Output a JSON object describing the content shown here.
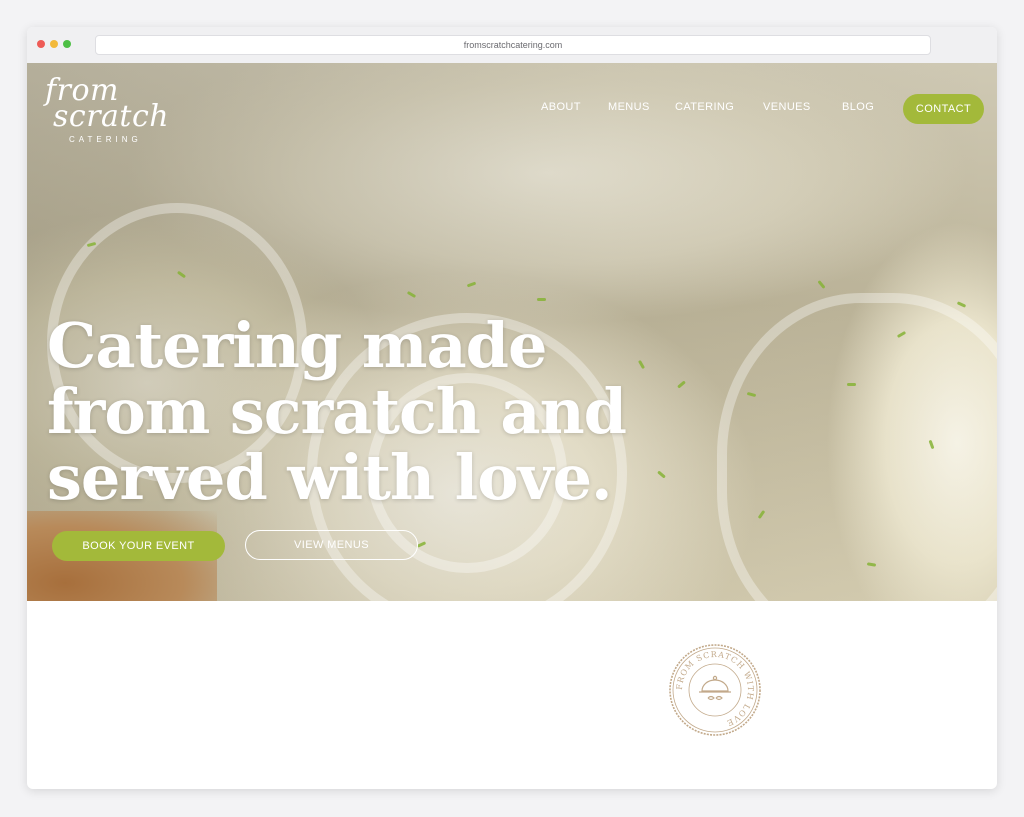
{
  "browser": {
    "url": "fromscratchcatering.com"
  },
  "logo": {
    "line1": "from",
    "line2": "scratch",
    "subtitle": "CATERING"
  },
  "nav": {
    "items": [
      "ABOUT",
      "MENUS",
      "CATERING",
      "VENUES",
      "BLOG"
    ],
    "contact_label": "CONTACT"
  },
  "hero": {
    "headline_lines": [
      "Catering made",
      "from scratch and",
      "served with love."
    ],
    "book_button": "BOOK YOUR EVENT",
    "menus_button": "VIEW MENUS"
  },
  "seal": {
    "text": "FROM SCRATCH WITH LOVE"
  },
  "colors": {
    "accent": "#a3b93a",
    "seal": "#c2a98a",
    "page_bg": "#f3f3f5"
  }
}
